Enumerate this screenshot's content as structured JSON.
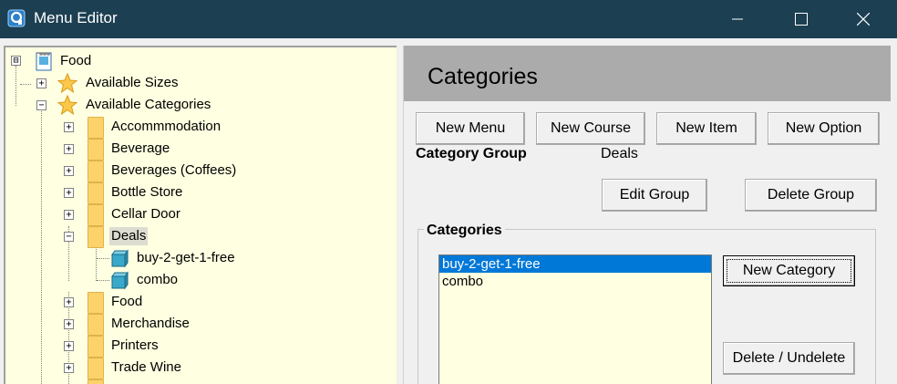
{
  "window": {
    "title": "Menu Editor",
    "colors": {
      "titlebar": "#1c3f52",
      "selection": "#0078d7",
      "list_background": "#ffffe1",
      "header_background": "#ababab"
    }
  },
  "tree": {
    "root": {
      "label": "Food",
      "icon": "document-icon",
      "expander": "⊟"
    },
    "sizes": {
      "label": "Available Sizes",
      "icon": "star-icon",
      "expander": "+"
    },
    "categories": {
      "label": "Available Categories",
      "icon": "star-icon",
      "expander": "−"
    },
    "items": [
      {
        "label": "Accommmodation",
        "expander": "+"
      },
      {
        "label": "Beverage",
        "expander": "+"
      },
      {
        "label": "Beverages (Coffees)",
        "expander": "+"
      },
      {
        "label": "Bottle Store",
        "expander": "+"
      },
      {
        "label": "Cellar Door",
        "expander": "+"
      },
      {
        "label": "Deals",
        "expander": "−"
      },
      {
        "label": "buy-2-get-1-free",
        "icon": "category-icon"
      },
      {
        "label": "combo",
        "icon": "category-icon"
      },
      {
        "label": "Food",
        "expander": "+"
      },
      {
        "label": "Merchandise",
        "expander": "+"
      },
      {
        "label": "Printers",
        "expander": "+"
      },
      {
        "label": "Trade Wine",
        "expander": "+"
      }
    ]
  },
  "panel": {
    "title": "Categories",
    "buttons": {
      "new_menu": "New Menu",
      "new_course": "New Course",
      "new_item": "New Item",
      "new_option": "New Option",
      "edit_group": "Edit Group",
      "delete_group": "Delete Group",
      "new_category": "New Category",
      "delete_undelete": "Delete / Undelete"
    },
    "category_group_label": "Category Group",
    "category_group_value": "Deals",
    "categories_group_title": "Categories",
    "categories_list": [
      "buy-2-get-1-free",
      "combo"
    ]
  }
}
